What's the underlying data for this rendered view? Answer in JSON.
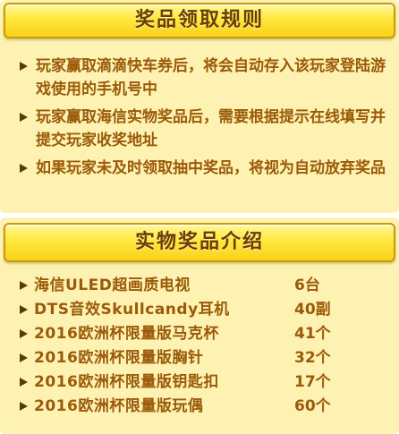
{
  "rules_section": {
    "title": "奖品领取规则",
    "items": [
      "玩家赢取滴滴快车券后，将会自动存入该玩家登陆游戏使用的手机号中",
      "玩家赢取海信实物奖品后，需要根据提示在线填写并提交玩家收奖地址",
      "如果玩家未及时领取抽中奖品，将视为自动放弃奖品"
    ]
  },
  "prizes_section": {
    "title": "实物奖品介绍",
    "items": [
      {
        "name": "海信ULED超画质电视",
        "qty": "6台"
      },
      {
        "name": "DTS音效Skullcandy耳机",
        "qty": "40副"
      },
      {
        "name": "2016欧洲杯限量版马克杯",
        "qty": "41个"
      },
      {
        "name": "2016欧洲杯限量版胸针",
        "qty": "32个"
      },
      {
        "name": "2016欧洲杯限量版钥匙扣",
        "qty": "17个"
      },
      {
        "name": "2016欧洲杯限量版玩偶",
        "qty": "60个"
      }
    ]
  },
  "colors": {
    "panel": "#fdf2b1",
    "header": "#ffe83d",
    "text": "#9b5a0a",
    "bullet": "#5a3a0d"
  }
}
